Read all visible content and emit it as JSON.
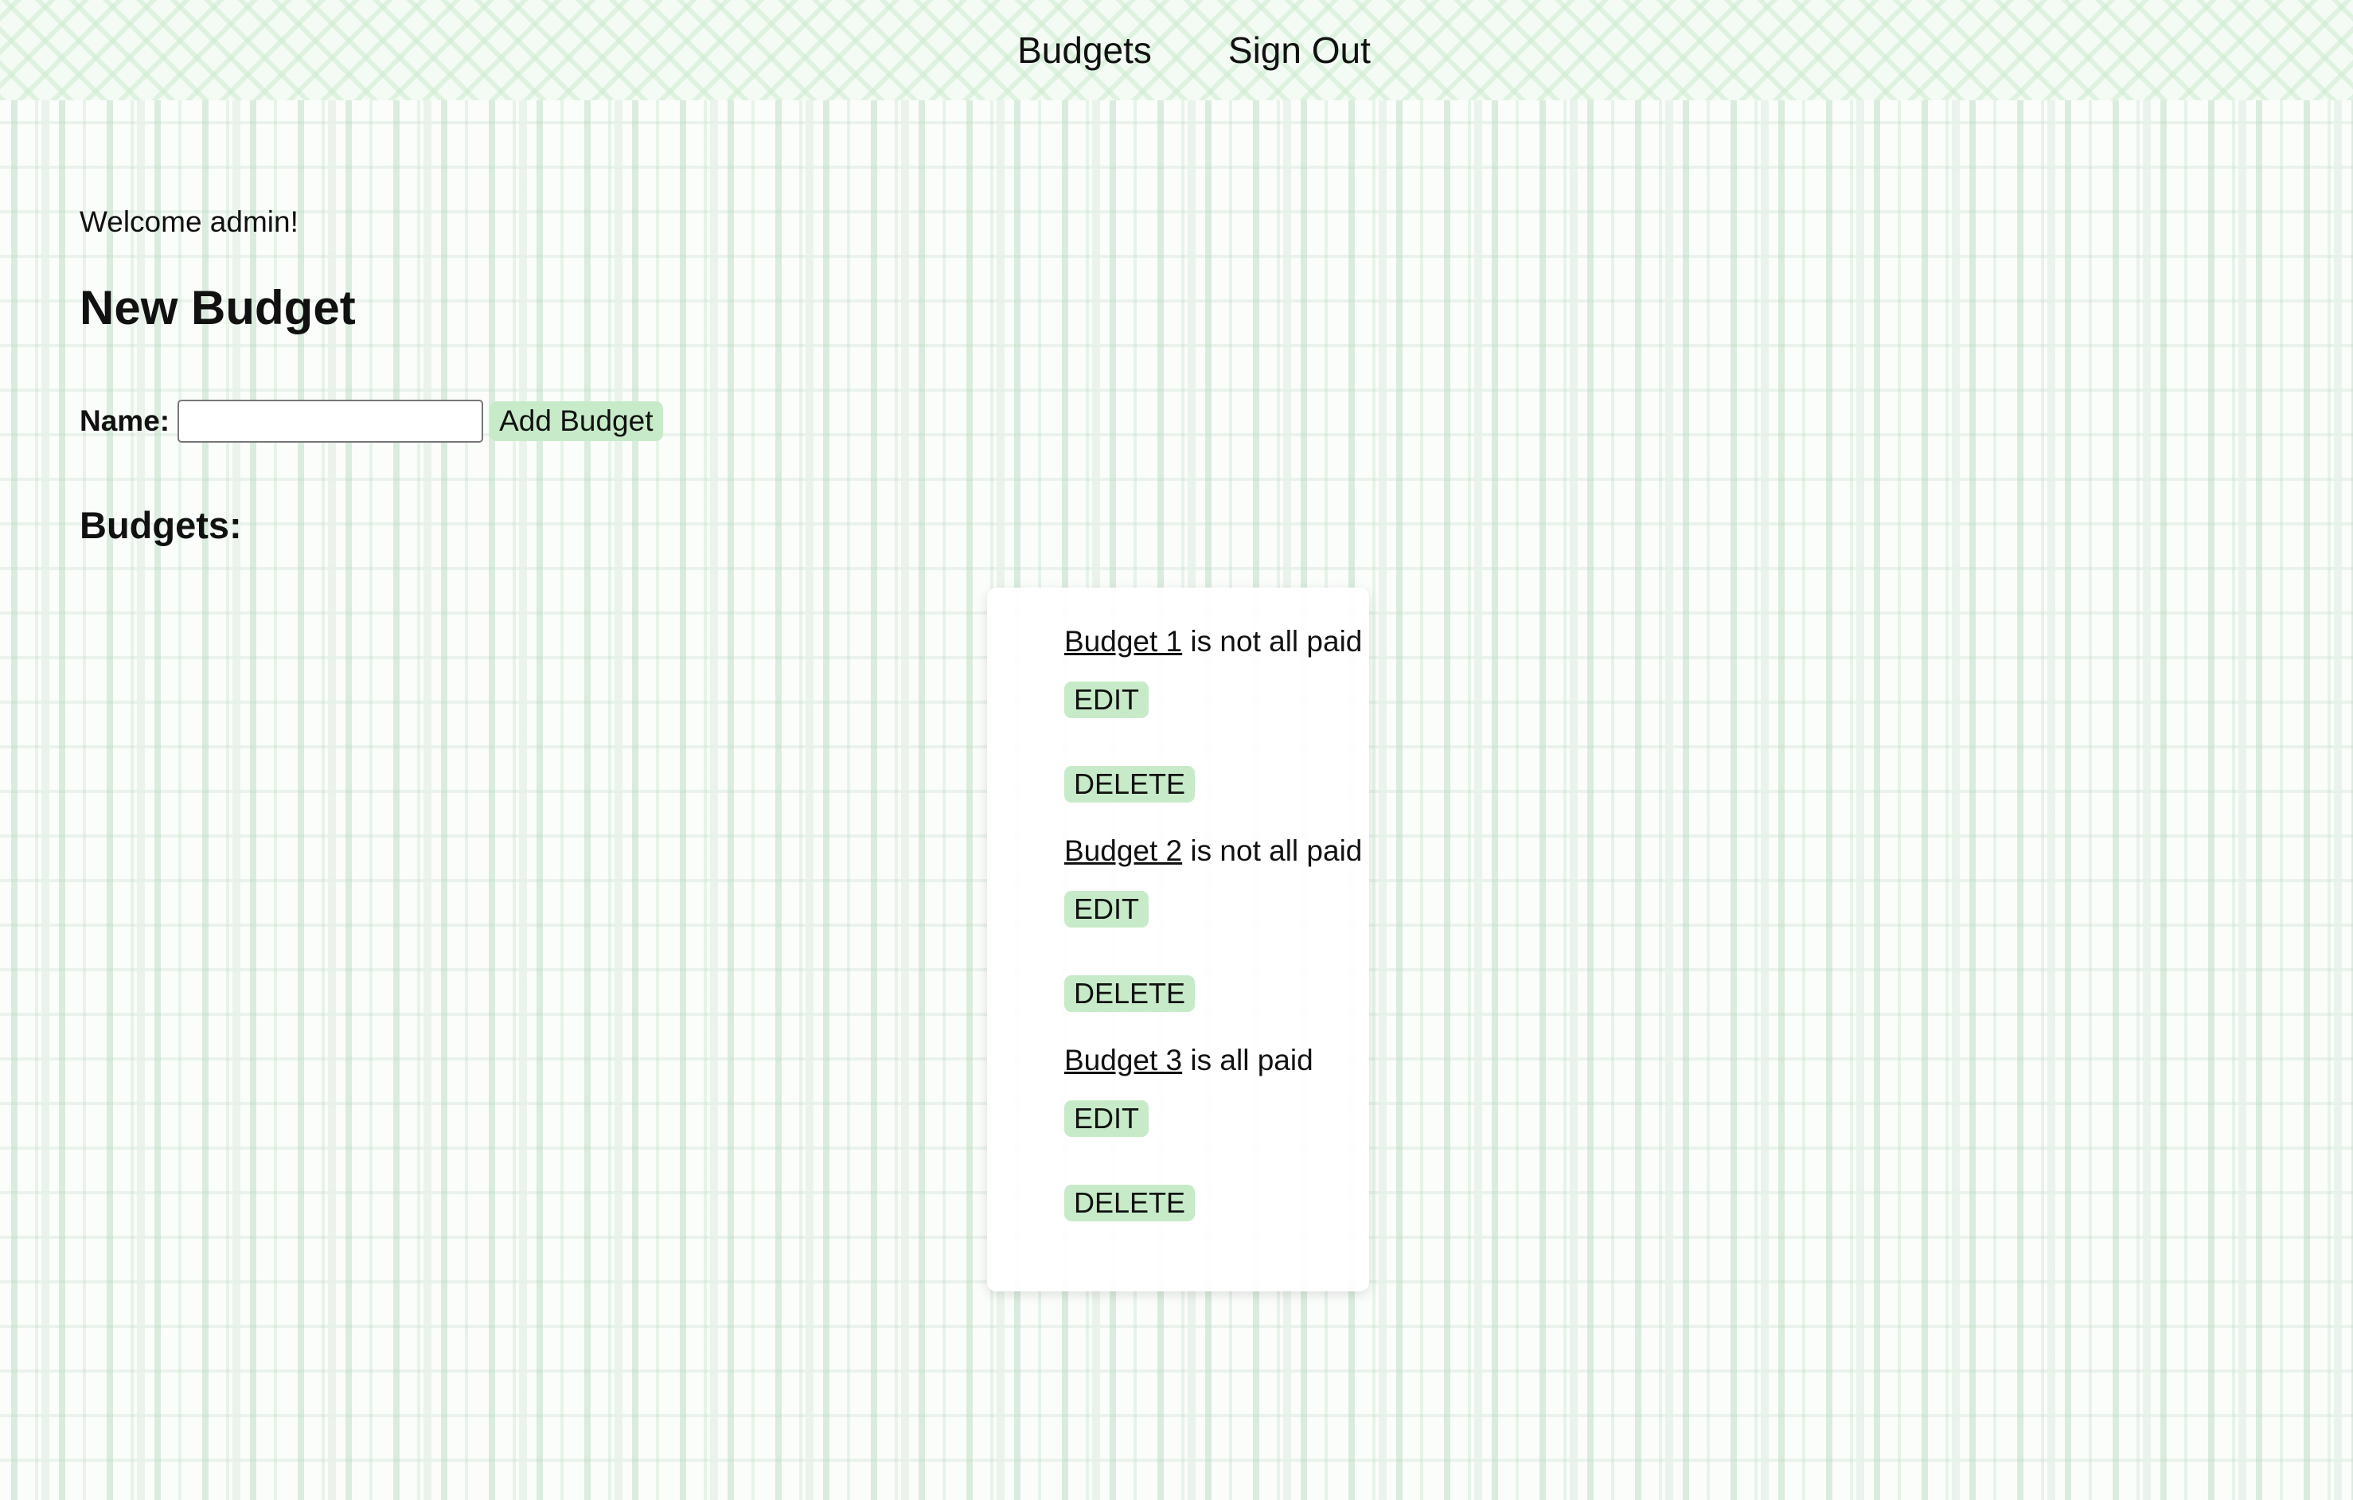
{
  "nav": {
    "budgets_label": "Budgets",
    "signout_label": "Sign Out"
  },
  "welcome_text": "Welcome admin!",
  "new_budget": {
    "title": "New Budget",
    "name_label": "Name:",
    "name_value": "",
    "add_button_label": "Add Budget"
  },
  "budgets_heading": "Budgets:",
  "budgets": [
    {
      "name": "Budget 1",
      "status": "is not all paid",
      "edit_label": "EDIT",
      "delete_label": "DELETE"
    },
    {
      "name": "Budget 2",
      "status": "is not all paid",
      "edit_label": "EDIT",
      "delete_label": "DELETE"
    },
    {
      "name": "Budget 3",
      "status": "is all paid",
      "edit_label": "EDIT",
      "delete_label": "DELETE"
    }
  ],
  "colors": {
    "button_bg": "#c7ebc8",
    "stripe": "#bedec4"
  }
}
